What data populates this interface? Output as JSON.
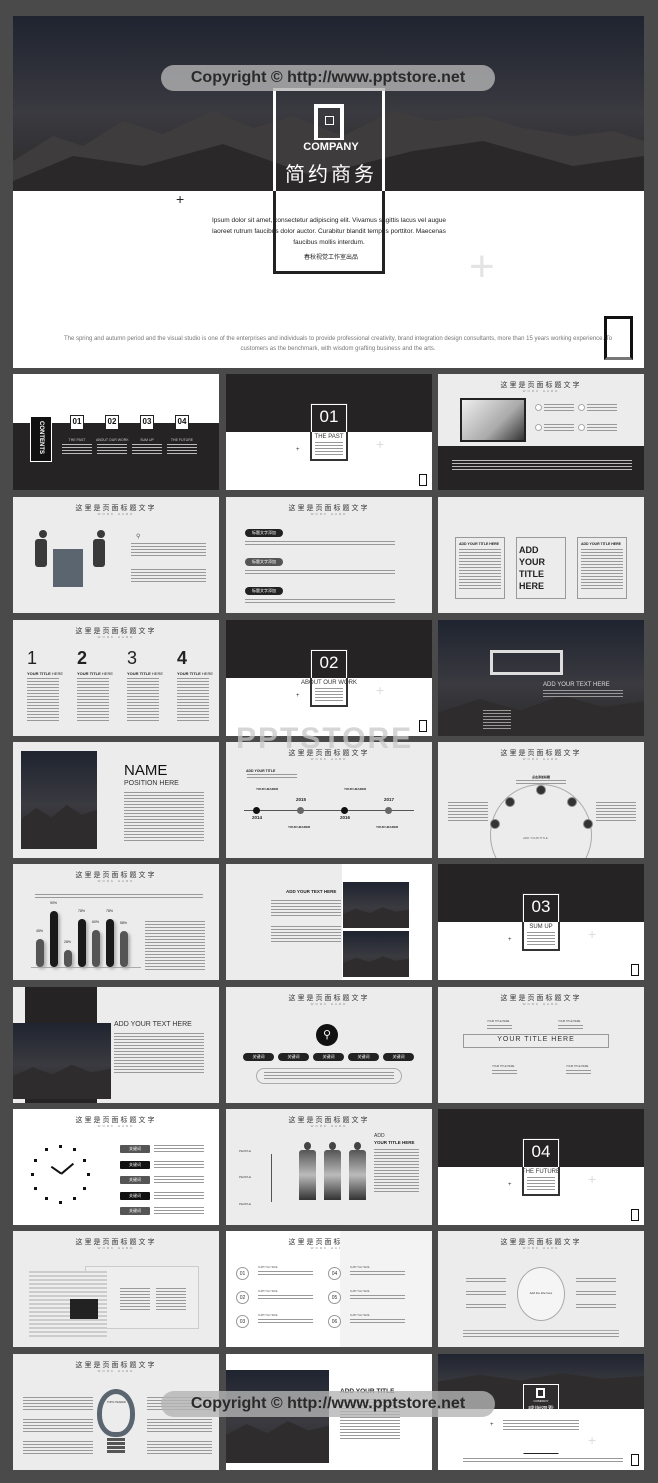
{
  "watermark": {
    "copyright": "Copyright © http://www.pptstore.net",
    "brand": "PPTSTORE"
  },
  "cover": {
    "logo_text": "COMPANY",
    "title": "简约商务",
    "body": "Ipsum dolor sit amet, consectetur adipiscing elit. Vivamus sagittis lacus vel augue laoreet rutrum faucibus dolor auctor. Curabitur blandit tempus porttitor. Maecenas faucibus mollis interdum.",
    "studio": "春秋视觉工作室出品",
    "footer": "The spring and autumn period and the visual studio is one of the enterprises and individuals to provide professional creativity, brand integration design consultants, more than 15 years working experience. To customers as the benchmark, with wisdom grafting business and the arts."
  },
  "common": {
    "page_title": "这里是页面标题文字",
    "page_subtitle": "WORK HARD"
  },
  "slides": {
    "contents": {
      "label": "CONTENTS",
      "items": [
        {
          "num": "01",
          "label": "THE PAST"
        },
        {
          "num": "02",
          "label": "ABOUT OUR WORK"
        },
        {
          "num": "03",
          "label": "SUM UP"
        },
        {
          "num": "04",
          "label": "THE FUTURE"
        }
      ]
    },
    "sections": [
      {
        "num": "01",
        "label": "THE PAST"
      },
      {
        "num": "02",
        "label": "ABOUT OUR WORK"
      },
      {
        "num": "03",
        "label": "SUM UP"
      },
      {
        "num": "04",
        "label": "THE FUTURE"
      }
    ],
    "pills": [
      "标题文字添加",
      "标题文字添加",
      "标题文字添加"
    ],
    "boxes": {
      "side": "ADD YOUR TITLE HERE",
      "center": "ADD YOUR TITLE HERE"
    },
    "numbers": {
      "items": [
        "1",
        "2",
        "3",
        "4"
      ],
      "label_bold": "YOUR TITLE",
      "label_light": "HERE"
    },
    "dark_text": "ADD YOUR TEXT HERE",
    "profile": {
      "name": "NAME",
      "position": "POSITION HERE"
    },
    "timeline": {
      "title": "ADD YOUR TITLE",
      "header": "YOUR HEADER",
      "years": [
        "2014",
        "2015",
        "2016",
        "2017"
      ]
    },
    "arc": {
      "center": "ADD YOUR TITLE",
      "label": "点击添加标题"
    },
    "photos_title": "ADD YOUR TEXT HERE",
    "photo_left_title": "ADD YOUR TEXT HERE",
    "keywords": [
      "关键词",
      "关键词",
      "关键词",
      "关键词",
      "关键词"
    ],
    "title_here": {
      "main": "YOUR TITLE HERE",
      "small": "YOUR TITLE HERE"
    },
    "clock_keywords": [
      "关键词",
      "关键词",
      "关键词",
      "关键词",
      "关键词"
    ],
    "people": {
      "add": "ADD",
      "title": "YOUR TITLE HERE",
      "labels": [
        "PEOPLE",
        "PEOPLE",
        "PEOPLE"
      ]
    },
    "six": {
      "nums": [
        "01",
        "02",
        "03",
        "04",
        "05",
        "06"
      ],
      "label": "SUBTITLE HERE"
    },
    "circle": "Add the title here",
    "bulb": {
      "label": "TOPIC HEADER"
    },
    "photo_title": "ADD YOUR TITLE",
    "thanks": {
      "logo_text": "COMPANY",
      "title": "感谢观看"
    }
  },
  "chart_data": {
    "type": "bar",
    "categories": [
      "",
      "",
      "",
      "",
      "",
      "",
      ""
    ],
    "values": [
      45,
      90,
      28,
      78,
      60,
      78,
      58
    ],
    "value_suffix": "%",
    "ylim": [
      0,
      100
    ],
    "colors": [
      "#555555",
      "#1a1a1a",
      "#555555",
      "#1a1a1a",
      "#555555",
      "#1a1a1a",
      "#555555"
    ]
  }
}
